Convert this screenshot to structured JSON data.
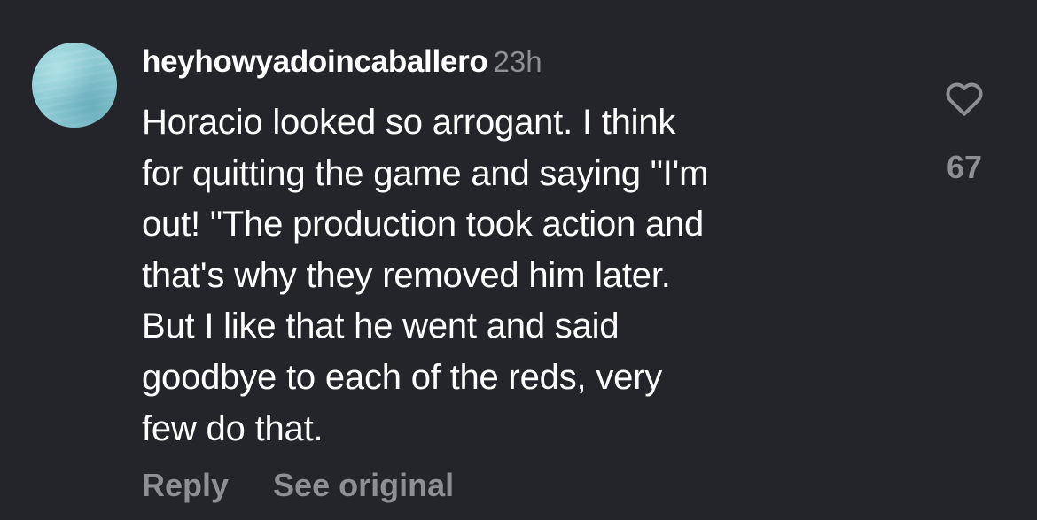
{
  "comment": {
    "username": "heyhowyadoincaballero",
    "timestamp": "23h",
    "text_lines": [
      "Horacio looked so arrogant. I think",
      "for quitting the game and saying \"I'm",
      "out! \"The production took action and",
      "that's why they removed him later.",
      "But I like that he went and said",
      "goodbye to each of the reds, very",
      "few do that."
    ],
    "like_count": "67",
    "actions": {
      "reply_label": "Reply",
      "see_original_label": "See original"
    }
  },
  "colors": {
    "background": "#24252a",
    "primary_text": "#ffffff",
    "secondary_text": "#8e8f95",
    "avatar": "#8ecbd3"
  },
  "icons": {
    "like": "heart-outline-icon"
  }
}
